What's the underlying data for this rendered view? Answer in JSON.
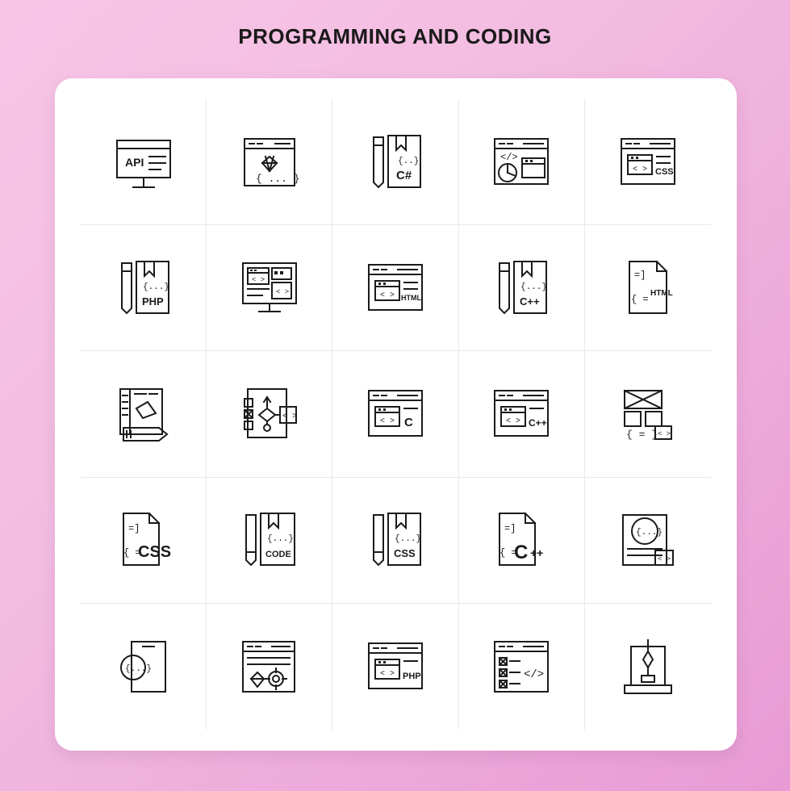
{
  "header": {
    "title": "PROGRAMMING AND CODING"
  },
  "colors": {
    "background_start": "#f7c5e6",
    "background_end": "#e79ad4",
    "card": "#ffffff",
    "stroke": "#1b1b1b",
    "grid_line": "#e9e9ec"
  },
  "grid": {
    "columns": 5,
    "rows": 5,
    "icons": [
      {
        "name": "api-monitor-icon",
        "label": "API",
        "row": 1,
        "col": 1
      },
      {
        "name": "browser-diamond-code-icon",
        "label": "{ ... }",
        "row": 1,
        "col": 2
      },
      {
        "name": "csharp-file-pencil-icon",
        "label": "C#",
        "row": 1,
        "col": 3
      },
      {
        "name": "browser-code-chart-icon",
        "label": "</>",
        "row": 1,
        "col": 4
      },
      {
        "name": "css-browser-icon",
        "label": "CSS",
        "row": 1,
        "col": 5
      },
      {
        "name": "php-file-pencil-icon",
        "label": "PHP",
        "row": 2,
        "col": 1
      },
      {
        "name": "desktop-code-windows-icon",
        "label": "",
        "row": 2,
        "col": 2
      },
      {
        "name": "html-browser-icon",
        "label": "HTML",
        "row": 2,
        "col": 3
      },
      {
        "name": "cplusplus-file-pencil-icon",
        "label": "C++",
        "row": 2,
        "col": 4
      },
      {
        "name": "html-document-icon",
        "label": "HTML",
        "row": 2,
        "col": 5
      },
      {
        "name": "design-layout-pencil-icon",
        "label": "",
        "row": 3,
        "col": 1
      },
      {
        "name": "flowchart-device-icon",
        "label": "",
        "row": 3,
        "col": 2
      },
      {
        "name": "c-browser-icon",
        "label": "C",
        "row": 3,
        "col": 3
      },
      {
        "name": "cplusplus-browser-icon",
        "label": "C++",
        "row": 3,
        "col": 4
      },
      {
        "name": "wireframe-blocks-code-icon",
        "label": "{ = }",
        "row": 3,
        "col": 5
      },
      {
        "name": "css-document-icon",
        "label": "CSS",
        "row": 4,
        "col": 1
      },
      {
        "name": "code-file-pencil-icon",
        "label": "CODE",
        "row": 4,
        "col": 2
      },
      {
        "name": "css-file-pencil-icon",
        "label": "CSS",
        "row": 4,
        "col": 3
      },
      {
        "name": "cplusplus-document-icon",
        "label": "C++",
        "row": 4,
        "col": 4
      },
      {
        "name": "code-page-window-icon",
        "label": "{...}",
        "row": 4,
        "col": 5
      },
      {
        "name": "mobile-code-search-icon",
        "label": "{...}",
        "row": 5,
        "col": 1
      },
      {
        "name": "browser-diamond-gear-icon",
        "label": "",
        "row": 5,
        "col": 2
      },
      {
        "name": "php-browser-icon",
        "label": "PHP",
        "row": 5,
        "col": 3
      },
      {
        "name": "code-checklist-browser-icon",
        "label": "</>",
        "row": 5,
        "col": 4
      },
      {
        "name": "testing-device-icon",
        "label": "",
        "row": 5,
        "col": 5
      }
    ]
  }
}
